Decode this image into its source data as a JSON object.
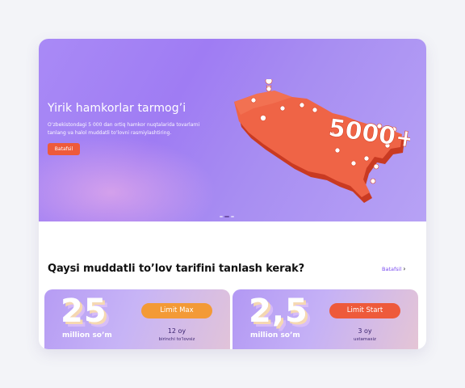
{
  "hero": {
    "title": "Yirik hamkorlar tarmog’i",
    "description": "O’zbekistondagi 5 000 dan ortiq hamkor nuqtalarida tovarlarni tanlang va halol muddatli to’lovni rasmiylashtiring.",
    "button_label": "Batafsil",
    "map_badge": "5000+",
    "slides_total": 3,
    "slide_active": 2,
    "colors": {
      "accent": "#ee5a3b",
      "hero_bg": "#a08af4"
    }
  },
  "tariffs_section": {
    "title": "Qaysi muddatli to’lov tarifini tanlash kerak?",
    "more_label": "Batafsil",
    "more_chevron": "›",
    "cards": [
      {
        "amount": "25",
        "unit": "million so’m",
        "name": "Limit Max",
        "term": "12 oy",
        "term_note": "birinchi to’lovsiz",
        "badge_color": "#f39a36"
      },
      {
        "amount": "2,5",
        "unit": "million so’m",
        "name": "Limit Start",
        "term": "3 oy",
        "term_note": "ustamasiz",
        "badge_color": "#ee5a3b"
      }
    ]
  }
}
